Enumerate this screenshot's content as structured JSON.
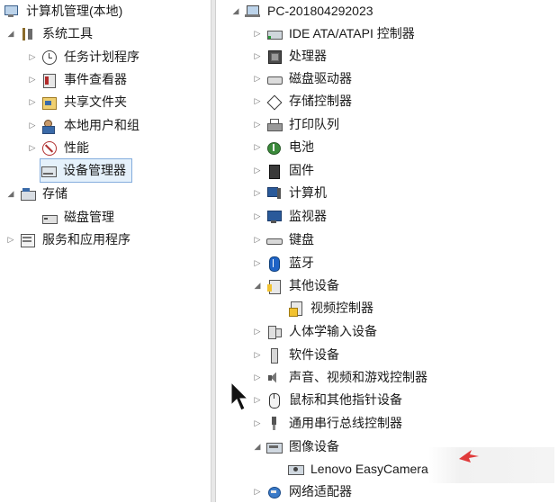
{
  "left_tree": {
    "root_label": "计算机管理(本地)",
    "system_tools": "系统工具",
    "task_scheduler": "任务计划程序",
    "event_viewer": "事件查看器",
    "shared_folders": "共享文件夹",
    "local_users": "本地用户和组",
    "performance": "性能",
    "device_manager": "设备管理器",
    "storage": "存储",
    "disk_management": "磁盘管理",
    "services_apps": "服务和应用程序"
  },
  "device_tree": {
    "computer_name": "PC-201804292023",
    "ide": "IDE ATA/ATAPI 控制器",
    "processor": "处理器",
    "disk_drives": "磁盘驱动器",
    "storage_ctrl": "存储控制器",
    "print_queue": "打印队列",
    "battery": "电池",
    "firmware": "固件",
    "computer": "计算机",
    "monitor": "监视器",
    "keyboard": "键盘",
    "bluetooth": "蓝牙",
    "other_devices": "其他设备",
    "video_controller": "视频控制器",
    "hid": "人体学输入设备",
    "software_devices": "软件设备",
    "sound": "声音、视频和游戏控制器",
    "mice": "鼠标和其他指针设备",
    "usb": "通用串行总线控制器",
    "imaging": "图像设备",
    "camera": "Lenovo EasyCamera",
    "network": "网络适配器"
  },
  "glyphs": {
    "collapsed": "▷",
    "expanded": "◢"
  },
  "colors": {
    "selection_bg": "#e5f1fb",
    "selection_border": "#84acdd",
    "warning": "#f2c230",
    "red_mark": "#e03a3a"
  }
}
